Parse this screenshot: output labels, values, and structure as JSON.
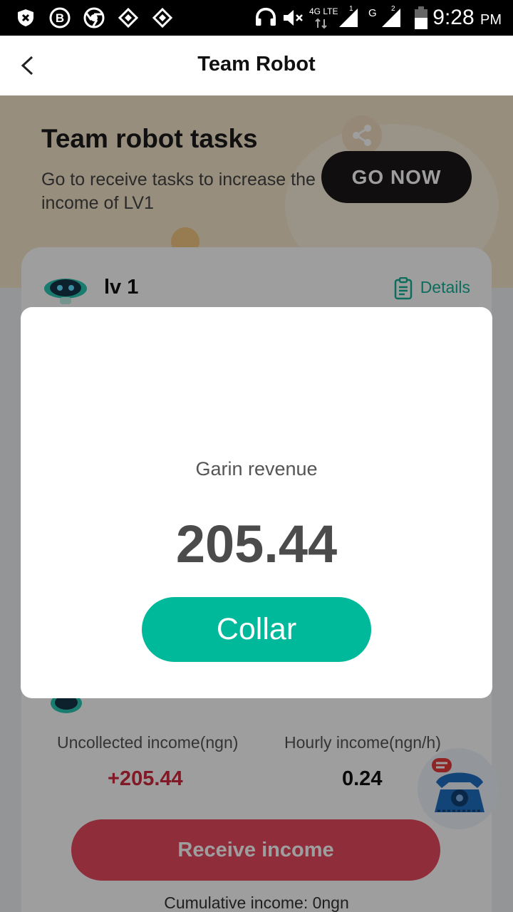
{
  "status_bar": {
    "network": "4G LTE",
    "sim1": "1",
    "carrier2": "G",
    "sim2": "2",
    "time": "9:28",
    "ampm": "PM"
  },
  "header": {
    "title": "Team Robot"
  },
  "banner": {
    "title": "Team robot tasks",
    "subtitle": "Go to receive tasks to increase the income of LV1",
    "button_label": "GO NOW"
  },
  "card": {
    "level": "lv 1",
    "details_label": "Details",
    "uncollected_label": "Uncollected income(ngn)",
    "uncollected_value": "+205.44",
    "hourly_label": "Hourly income(ngn/h)",
    "hourly_value": "0.24",
    "receive_button": "Receive income",
    "cumulative": "Cumulative income: 0ngn"
  },
  "modal": {
    "title": "Garin revenue",
    "amount": "205.44",
    "button_label": "Collar"
  },
  "colors": {
    "accent_teal": "#00b89a",
    "receive_red": "#e84a5f",
    "uncollected_red": "#d12a3e",
    "banner_bg": "#f6e6cb"
  }
}
